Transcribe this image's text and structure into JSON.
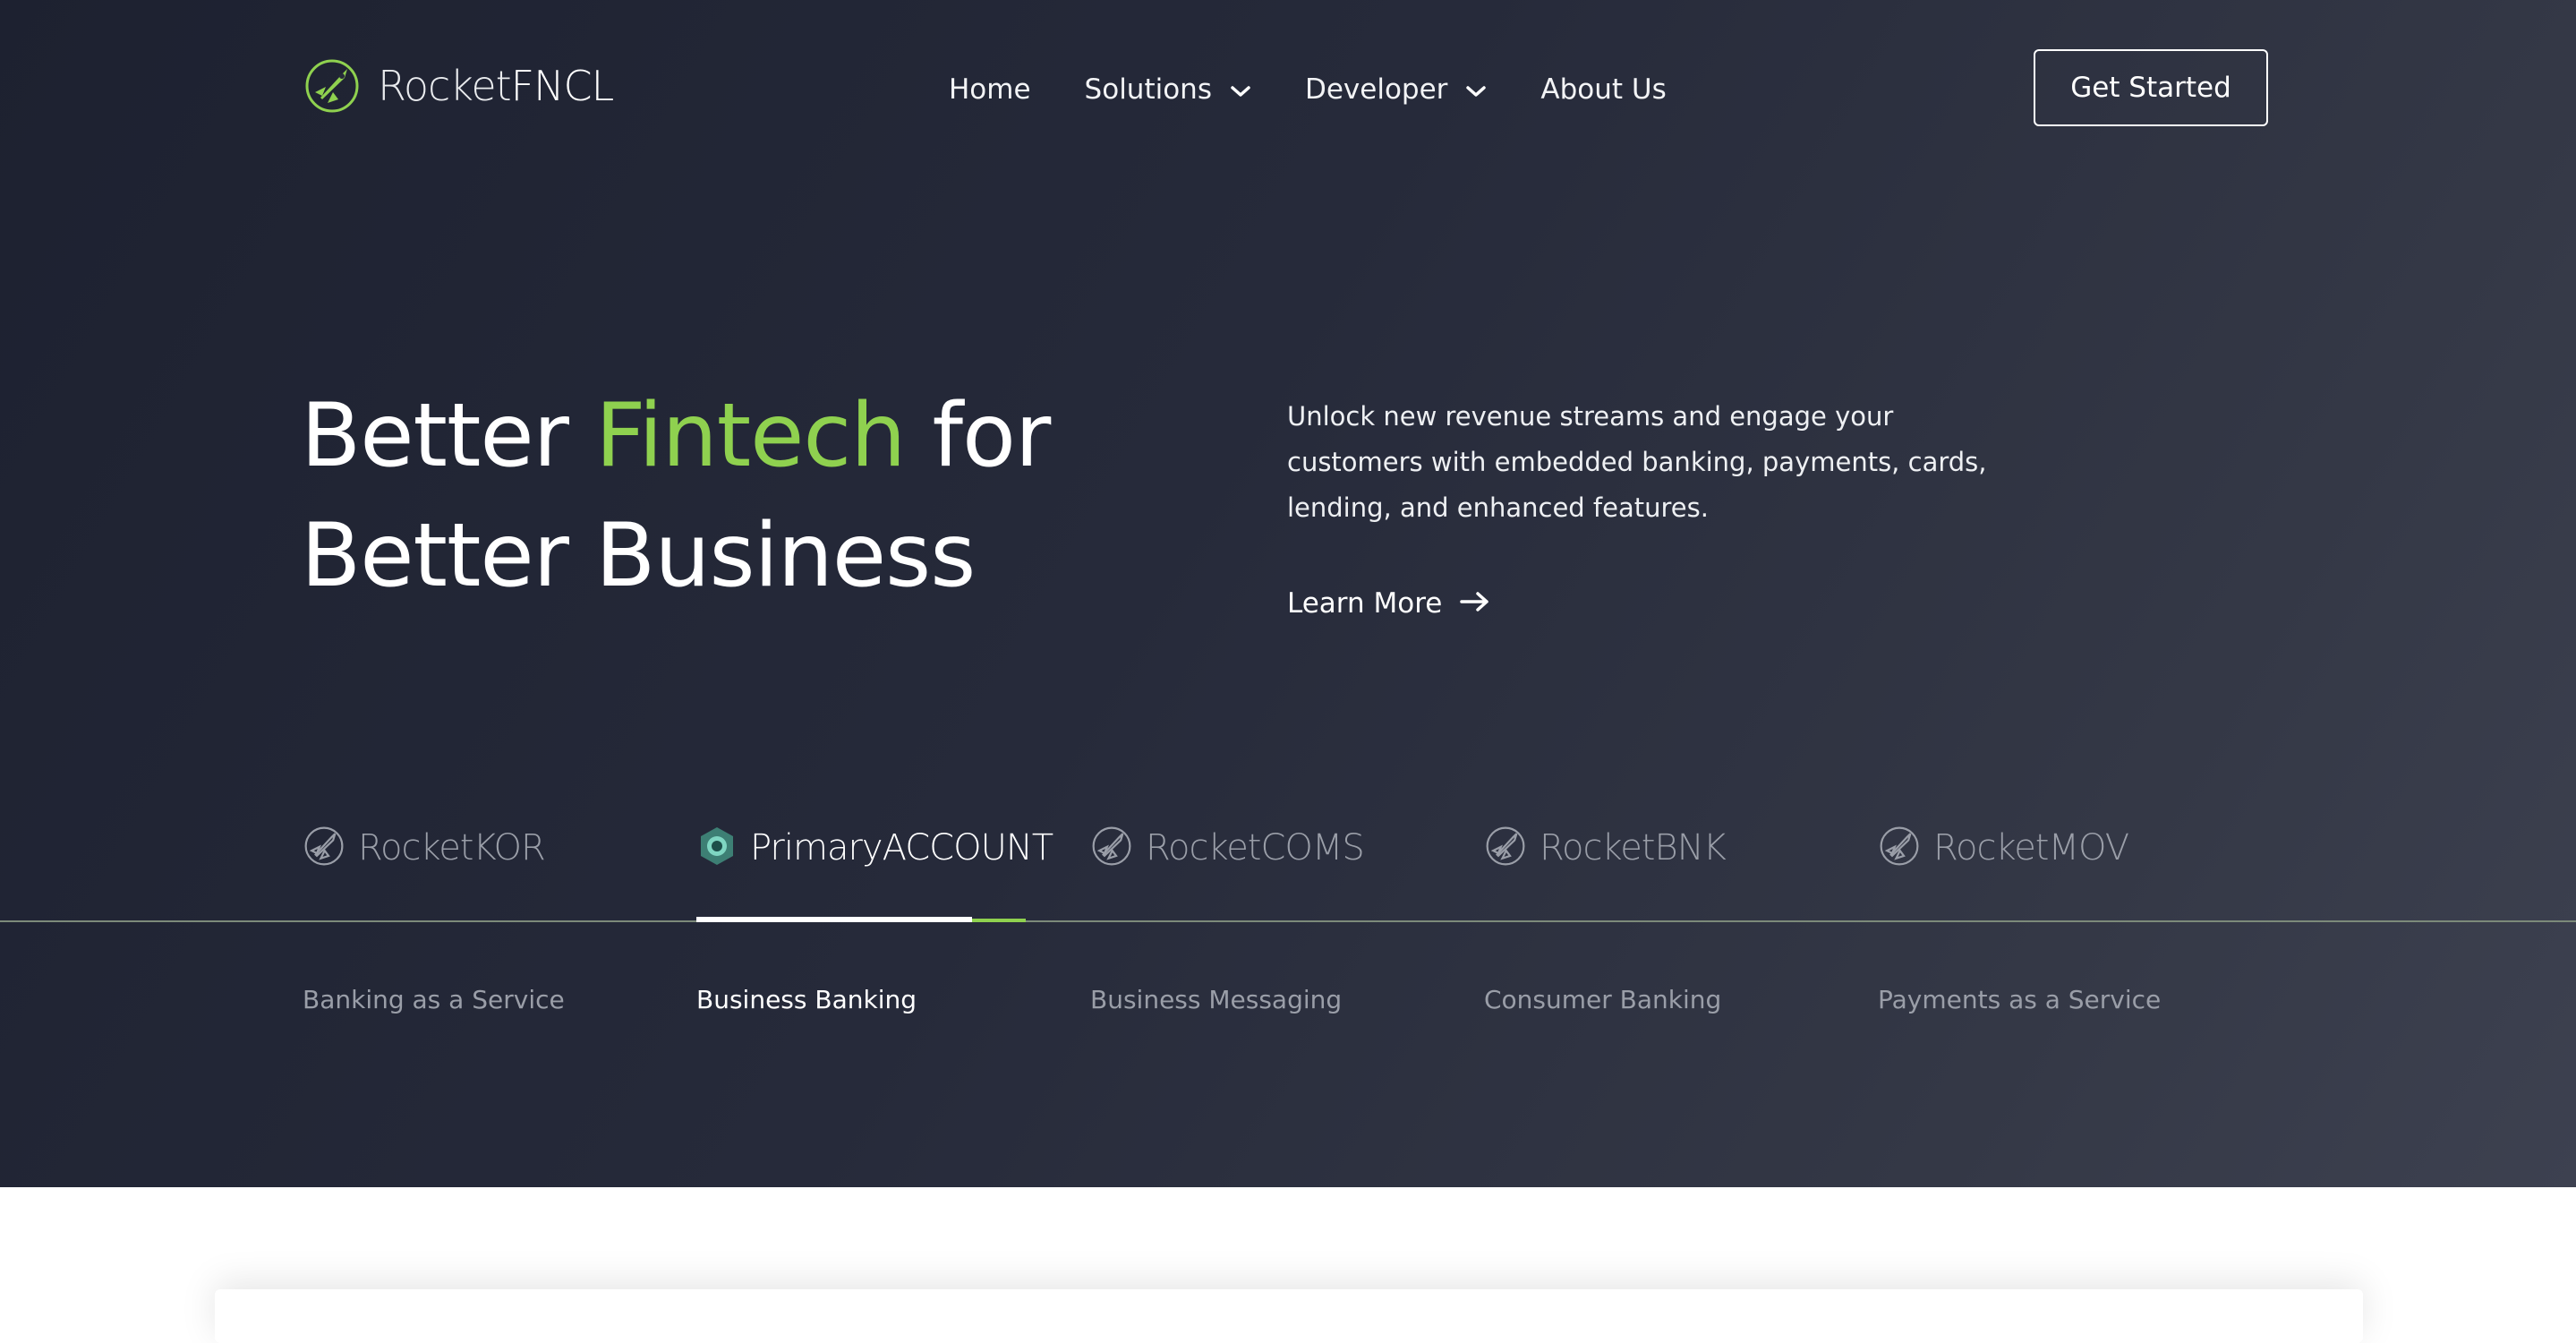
{
  "brand": {
    "name_part1": "Rocket",
    "name_part2": "FNCL",
    "logo_icon": "rocket-icon",
    "accent_color": "#8fd14f"
  },
  "nav": {
    "items": [
      {
        "label": "Home",
        "has_dropdown": false
      },
      {
        "label": "Solutions",
        "has_dropdown": true
      },
      {
        "label": "Developer",
        "has_dropdown": true
      },
      {
        "label": "About Us",
        "has_dropdown": false
      }
    ],
    "cta_label": "Get Started"
  },
  "hero": {
    "headline_part1": "Better ",
    "headline_accent": "Fintech",
    "headline_part2": " for",
    "headline_line2": "Better Business",
    "subtext": "Unlock new revenue streams and engage your customers with embedded banking, payments, cards, lending, and enhanced features.",
    "learn_more": "Learn More"
  },
  "products": {
    "active_index": 1,
    "tabs": [
      {
        "brand_a": "Rocket",
        "brand_b": "KOR",
        "label": "Banking as a Service",
        "icon": "rocket-icon"
      },
      {
        "brand_a": "Primary",
        "brand_b": "ACCOUNT",
        "label": "Business Banking",
        "icon": "primary-account-icon"
      },
      {
        "brand_a": "Rocket",
        "brand_b": "COMS",
        "label": "Business Messaging",
        "icon": "rocket-icon"
      },
      {
        "brand_a": "Rocket",
        "brand_b": "BNK",
        "label": "Consumer Banking",
        "icon": "rocket-icon"
      },
      {
        "brand_a": "Rocket",
        "brand_b": "MOV",
        "label": "Payments as a Service",
        "icon": "rocket-icon"
      }
    ]
  }
}
